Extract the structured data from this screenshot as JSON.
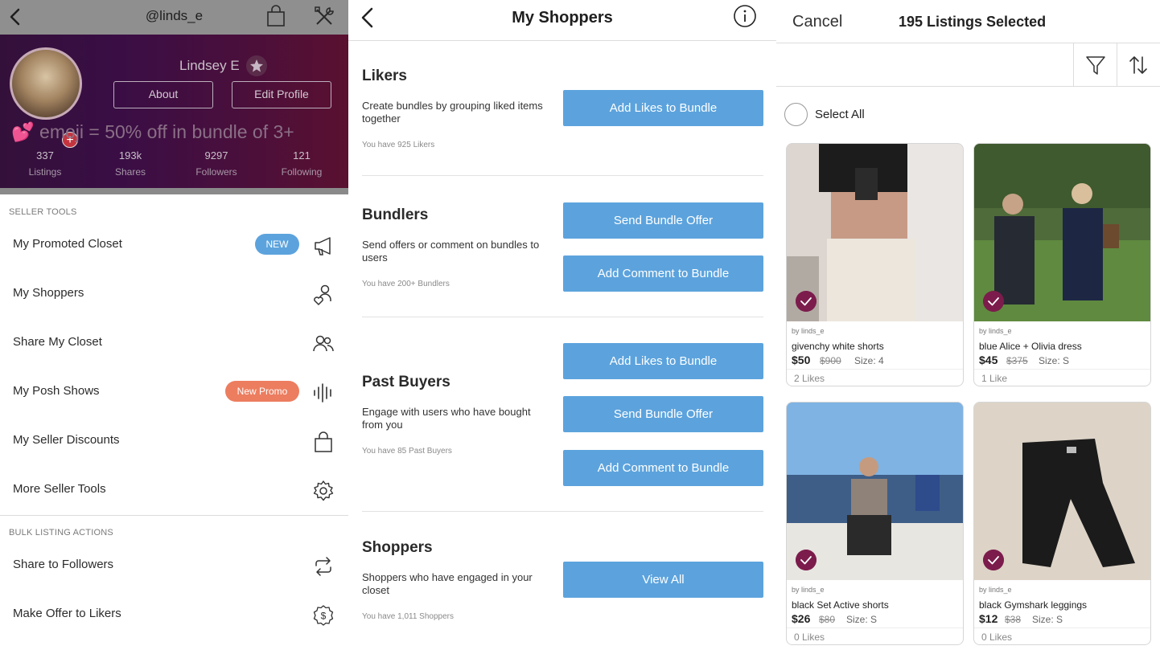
{
  "panel1": {
    "handle": "@linds_e",
    "profile": {
      "name": "Lindsey E",
      "about_label": "About",
      "edit_label": "Edit Profile",
      "bio": "💕 emoji = 50% off in bundle of 3+",
      "stats": [
        {
          "value": "337",
          "label": "Listings"
        },
        {
          "value": "193k",
          "label": "Shares"
        },
        {
          "value": "9297",
          "label": "Followers"
        },
        {
          "value": "121",
          "label": "Following"
        }
      ]
    },
    "seller_tools_header": "SELLER TOOLS",
    "seller_tools": [
      {
        "label": "My Promoted Closet",
        "badge": "NEW",
        "icon": "megaphone-icon"
      },
      {
        "label": "My Shoppers",
        "icon": "shoppers-icon"
      },
      {
        "label": "Share My Closet",
        "icon": "people-icon"
      },
      {
        "label": "My Posh Shows",
        "badge": "New Promo",
        "icon": "audio-wave-icon"
      },
      {
        "label": "My Seller Discounts",
        "icon": "bag-icon"
      },
      {
        "label": "More Seller Tools",
        "icon": "gear-icon"
      }
    ],
    "bulk_header": "BULK LISTING ACTIONS",
    "bulk_actions": [
      {
        "label": "Share to Followers",
        "icon": "share-cycle-icon"
      },
      {
        "label": "Make Offer to Likers",
        "icon": "dollar-coin-icon"
      }
    ],
    "colors": {
      "new_badge": "#5ca3dd",
      "promo_badge": "#ec7d5f"
    }
  },
  "panel2": {
    "title": "My Shoppers",
    "sections": {
      "likers": {
        "title": "Likers",
        "desc": "Create bundles by grouping liked items together",
        "count": "You have 925 Likers",
        "buttons": [
          "Add Likes to Bundle"
        ]
      },
      "bundlers": {
        "title": "Bundlers",
        "desc": "Send offers or comment on bundles to users",
        "count": "You have 200+ Bundlers",
        "buttons": [
          "Send Bundle Offer",
          "Add Comment to Bundle"
        ]
      },
      "past_buyers": {
        "title": "Past Buyers",
        "desc": "Engage with users who have bought from you",
        "count": "You have 85 Past Buyers",
        "buttons": [
          "Add Likes to Bundle",
          "Send Bundle Offer",
          "Add Comment to Bundle"
        ]
      },
      "shoppers": {
        "title": "Shoppers",
        "desc": "Shoppers who have engaged in your closet",
        "count": "You have 1,011 Shoppers",
        "buttons": [
          "View All"
        ]
      }
    },
    "colors": {
      "button": "#5ca3dd"
    }
  },
  "panel3": {
    "cancel_label": "Cancel",
    "title": "195 Listings Selected",
    "select_all_label": "Select All",
    "listings": [
      {
        "by": "by linds_e",
        "name": "givenchy white shorts",
        "price": "$50",
        "original": "$900",
        "size": "Size: 4",
        "likes": "2 Likes"
      },
      {
        "by": "by linds_e",
        "name": "blue Alice + Olivia dress",
        "price": "$45",
        "original": "$375",
        "size": "Size: S",
        "likes": "1 Like"
      },
      {
        "by": "by linds_e",
        "name": "black Set Active shorts",
        "price": "$26",
        "original": "$80",
        "size": "Size: S",
        "likes": "0 Likes"
      },
      {
        "by": "by linds_e",
        "name": "black Gymshark leggings",
        "price": "$12",
        "original": "$38",
        "size": "Size: S",
        "likes": "0 Likes"
      }
    ],
    "colors": {
      "check": "#7c1c4c"
    }
  }
}
